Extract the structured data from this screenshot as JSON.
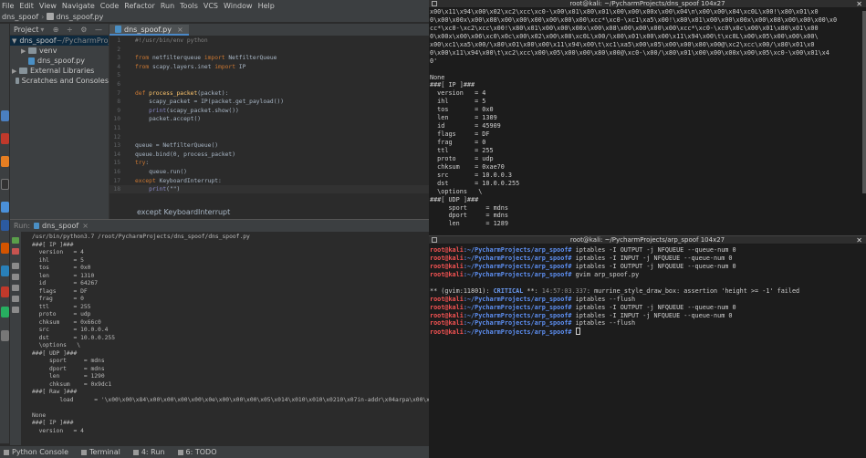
{
  "menu": [
    "File",
    "Edit",
    "View",
    "Navigate",
    "Code",
    "Refactor",
    "Run",
    "Tools",
    "VCS",
    "Window",
    "Help"
  ],
  "breadcrumb": [
    "dns_spoof",
    "dns_spoof.py"
  ],
  "project_panel": {
    "title": "Project",
    "tree": [
      {
        "label": "dns_spoof",
        "suffix": "~/PycharmProjec",
        "arrow": "▼",
        "indent": 0,
        "icon": "folder"
      },
      {
        "label": "venv",
        "suffix": "",
        "arrow": "▶",
        "indent": 1,
        "icon": "folder"
      },
      {
        "label": "dns_spoof.py",
        "suffix": "",
        "arrow": "",
        "indent": 1,
        "icon": "python-file"
      },
      {
        "label": "External Libraries",
        "suffix": "",
        "arrow": "▶",
        "indent": 0,
        "icon": "library"
      },
      {
        "label": "Scratches and Consoles",
        "suffix": "",
        "arrow": "",
        "indent": 0,
        "icon": "scratch"
      }
    ]
  },
  "editor": {
    "tab_label": "dns_spoof.py",
    "lines": [
      {
        "n": "1",
        "t": "#!/usr/bin/env python"
      },
      {
        "n": "2",
        "t": ""
      },
      {
        "n": "3",
        "t": "from netfilterqueue import NetfilterQueue"
      },
      {
        "n": "4",
        "t": "from scapy.layers.inet import IP"
      },
      {
        "n": "5",
        "t": ""
      },
      {
        "n": "6",
        "t": ""
      },
      {
        "n": "7",
        "t": "def process_packet(packet):"
      },
      {
        "n": "8",
        "t": "    scapy_packet = IP(packet.get_payload())"
      },
      {
        "n": "9",
        "t": "    print(scapy_packet.show())"
      },
      {
        "n": "10",
        "t": "    packet.accept()"
      },
      {
        "n": "11",
        "t": ""
      },
      {
        "n": "12",
        "t": ""
      },
      {
        "n": "13",
        "t": "queue = NetfilterQueue()"
      },
      {
        "n": "14",
        "t": "queue.bind(0, process_packet)"
      },
      {
        "n": "15",
        "t": "try:"
      },
      {
        "n": "16",
        "t": "    queue.run()"
      },
      {
        "n": "17",
        "t": "except KeyboardInterrupt:"
      },
      {
        "n": "18",
        "t": "    print(\"\")"
      }
    ],
    "hint": "except KeyboardInterrupt"
  },
  "run_panel": {
    "tab_label": "dns_spoof",
    "output": [
      "/usr/bin/python3.7 /root/PycharmProjects/dns_spoof/dns_spoof.py",
      "###[ IP ]###",
      "  version   = 4",
      "  ihl       = 5",
      "  tos       = 0x0",
      "  len       = 1310",
      "  id        = 64267",
      "  flags     = DF",
      "  frag      = 0",
      "  ttl       = 255",
      "  proto     = udp",
      "  chksum    = 0x66c0",
      "  src       = 10.0.0.4",
      "  dst       = 10.0.0.255",
      "  \\options   \\",
      "###[ UDP ]###",
      "     sport     = mdns",
      "     dport     = mdns",
      "     len       = 1290",
      "     chksum    = 0x9dc1",
      "###[ Raw ]###",
      "        load      = '\\x00\\x00\\x84\\x00\\x00\\x00\\x00\\x0e\\x00\\x00\\x00\\x05\\x014\\x010\\x010\\x0210\\x07in-addr\\x04arpa\\x00\\x00\\x0c\\x",
      "",
      "None",
      "###[ IP ]###",
      "  version   = 4"
    ]
  },
  "bottom_tabs": [
    "Python Console",
    "Terminal",
    "4: Run",
    "6: TODO"
  ],
  "term1": {
    "title": "root@kali: ~/PycharmProjects/dns_spoof 104x27",
    "lines": [
      "x00\\x11\\x94\\x00\\x02\\xc2\\xcc\\xc0-\\x00\\x01\\x80\\x01\\x00\\x00\\x00x\\x00\\x04\\n\\x00\\x00\\x04\\xc0L\\x00!\\x80\\x01\\x0",
      "0\\x00\\x00x\\x00\\x08\\x00\\x00\\x00\\x00\\x00\\x00\\xcc*\\xc0-\\xc1\\xa5\\x00!\\x80\\x01\\x00\\x00\\x00x\\x00\\x08\\x00\\x00\\x00\\x0",
      "cc*\\xc0-\\xc2\\xcc\\x00!\\x80\\x01\\x00\\x00\\x00x\\x00\\x08\\x00\\x00\\x00\\x00\\xcc*\\xc0-\\xc0\\x0c\\x00\\x01\\x80\\x01\\x00",
      "0\\x00x\\x00\\x06\\xc0\\x0c\\x00\\x02\\x00\\x08\\xc0L\\x00/\\x80\\x01\\x00\\x00\\x11\\x94\\x00\\t\\xc0L\\x00\\x05\\x00\\x00\\x00\\",
      "x00\\xc1\\xa5\\x00/\\x80\\x01\\x00\\x00\\x11\\x94\\x00\\t\\xc1\\xa5\\x00\\x05\\x00\\x00\\x80\\x00@\\xc2\\xcc\\x00/\\x80\\x01\\x0",
      "0\\x00\\x11\\x94\\x00\\t\\xc2\\xcc\\x00\\x05\\x00\\x00\\x80\\x00@\\xc0-\\x00/\\x80\\x01\\x00\\x00\\x00x\\x00\\x05\\xc0-\\x00\\x01\\x4",
      "0'",
      "",
      "None",
      "###[ IP ]###",
      "  version   = 4",
      "  ihl       = 5",
      "  tos       = 0x0",
      "  len       = 1309",
      "  id        = 45909",
      "  flags     = DF",
      "  frag      = 0",
      "  ttl       = 255",
      "  proto     = udp",
      "  chksum    = 0xae70",
      "  src       = 10.0.0.3",
      "  dst       = 10.0.0.255",
      "  \\options   \\",
      "###[ UDP ]###",
      "     sport     = mdns",
      "     dport     = mdns",
      "     len       = 1289"
    ]
  },
  "term2": {
    "title": "root@kali: ~/PycharmProjects/arp_spoof 104x27",
    "prompt_user": "root@kali",
    "prompt_path": ":~/PycharmProjects/arp_spoof#",
    "lines": [
      {
        "type": "cmd",
        "text": "iptables -I OUTPUT -j NFQUEUE --queue-num 0"
      },
      {
        "type": "cmd",
        "text": "iptables -I INPUT -j NFQUEUE --queue-num 0"
      },
      {
        "type": "cmd",
        "text": "iptables -I OUTPUT -j NFQUEUE --queue-num 0"
      },
      {
        "type": "cmd",
        "text": "gvim arp_spoof.py"
      },
      {
        "type": "blank",
        "text": ""
      },
      {
        "type": "crit",
        "pre": "** (gvim:11801): ",
        "crit": "CRITICAL",
        "mid": " **: ",
        "ts": "14:57:03.337",
        "post": ": murrine_style_draw_box: assertion 'height >= -1' failed"
      },
      {
        "type": "cmd",
        "text": "iptables --flush"
      },
      {
        "type": "cmd",
        "text": "iptables -I OUTPUT -j NFQUEUE --queue-num 0"
      },
      {
        "type": "cmd",
        "text": "iptables -I INPUT -j NFQUEUE --queue-num 0"
      },
      {
        "type": "cmd",
        "text": "iptables --flush"
      },
      {
        "type": "cursor",
        "text": ""
      }
    ]
  },
  "colors": {
    "prompt_user": "#f55353",
    "prompt_path": "#5d8ff2",
    "keyword": "#cc7832",
    "function": "#ffc66d"
  }
}
